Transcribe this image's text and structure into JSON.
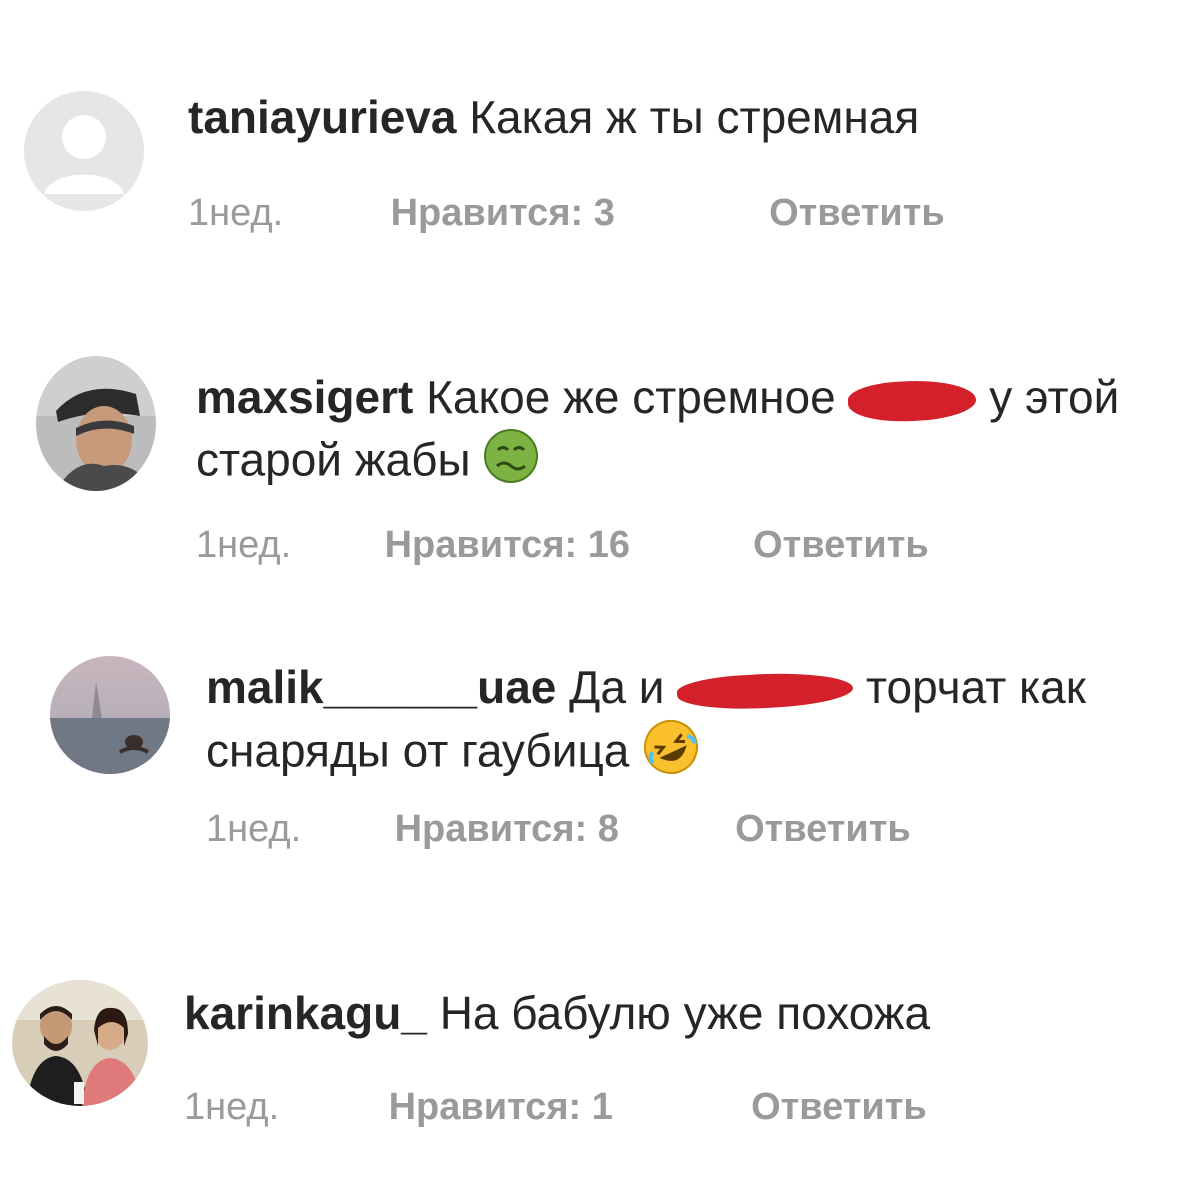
{
  "comments": [
    {
      "username": "taniayurieva",
      "text": "Какая ж ты стремная",
      "time": "1нед.",
      "likes": "Нравится: 3",
      "reply": "Ответить"
    },
    {
      "username": "maxsigert",
      "text_before": "Какое же стремное",
      "text_after": "у этой старой жабы",
      "emoji": "nauseated-face-icon",
      "time": "1нед.",
      "likes": "Нравится: 16",
      "reply": "Ответить"
    },
    {
      "username": "malik______uae",
      "text_before": "Да и",
      "text_after": "торчат как снаряды от гаубица",
      "emoji": "rofl-face-icon",
      "time": "1нед.",
      "likes": "Нравится: 8",
      "reply": "Ответить"
    },
    {
      "username": "karinkagu_",
      "text": "На бабулю уже похожа",
      "time": "1нед.",
      "likes": "Нравится: 1",
      "reply": "Ответить"
    }
  ],
  "colors": {
    "meta_gray": "#999999",
    "redaction_red": "#d4202a",
    "text": "#262626"
  }
}
